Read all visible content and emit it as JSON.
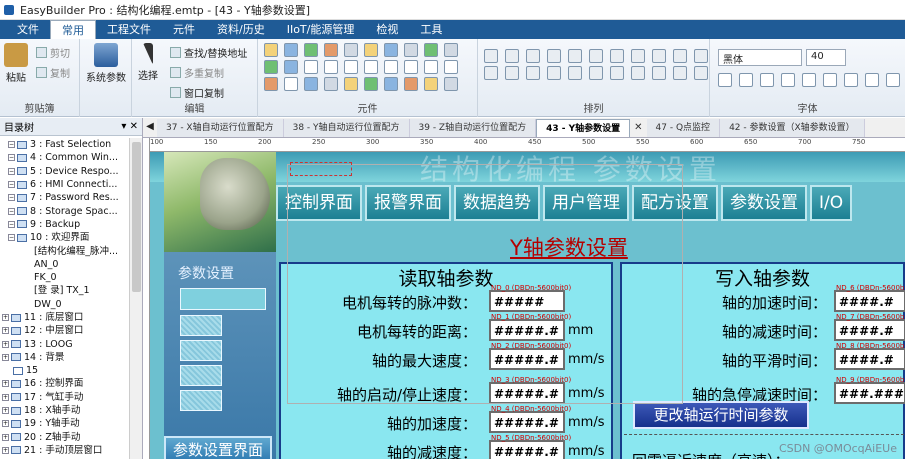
{
  "window": {
    "title": "EasyBuilder Pro : 结构化编程.emtp - [43 - Y轴参数设置]"
  },
  "menu": [
    "文件",
    "常用",
    "工程文件",
    "元件",
    "资料/历史",
    "IIoT/能源管理",
    "检视",
    "工具"
  ],
  "menu_active": "常用",
  "ribbon": {
    "clipboard": {
      "paste": "粘贴",
      "cut": "剪切",
      "copy": "复制",
      "group": "剪贴簿"
    },
    "system_params": "系统参数",
    "edit": {
      "select": "选择",
      "find": "查找/替换地址",
      "multi_copy": "多重复制",
      "window_copy": "窗口复制",
      "group": "编辑"
    },
    "elements_group": "元件",
    "arrange_group": "排列",
    "font": {
      "family": "黑体",
      "size": "40",
      "group": "字体"
    }
  },
  "tree": {
    "header": "目录树",
    "items": [
      "3 : Fast Selection",
      "4 : Common Win...",
      "5 : Device Respo...",
      "6 : HMI Connecti...",
      "7 : Password Res...",
      "8 : Storage Spac...",
      "9 : Backup",
      "10 : 欢迎界面",
      "[结构化编程_脉冲...",
      "AN_0",
      "FK_0",
      "[登 录] TX_1",
      "DW_0",
      "11 : 底层窗口",
      "12 : 中层窗口",
      "13 : LOOG",
      "14 : 背景",
      "15",
      "16 : 控制界面",
      "17 : 气缸手动",
      "18 : X轴手动",
      "19 : Y轴手动",
      "20 : Z轴手动",
      "21 : 手动顶层窗口"
    ]
  },
  "tabs": [
    "37 - X轴自动运行位置配方",
    "38 - Y轴自动运行位置配方",
    "39 - Z轴自动运行位置配方",
    "43 - Y轴参数设置",
    "47 - Q点监控",
    "42 - 参数设置（X轴参数设置）"
  ],
  "tab_active": "43 - Y轴参数设置",
  "ruler_ticks": [
    "100",
    "150",
    "200",
    "250",
    "300",
    "350",
    "400",
    "450",
    "500",
    "550",
    "600",
    "650",
    "700",
    "750"
  ],
  "screen": {
    "bg_title": "结构化编程 参数设置",
    "side_title": "参数设置",
    "side_bottom": "参数设置界面",
    "nav": [
      "控制界面",
      "报警界面",
      "数据趋势",
      "用户管理",
      "配方设置",
      "参数设置",
      "I/O"
    ],
    "title": "Y轴参数设置",
    "read": {
      "title": "读取轴参数",
      "fields": [
        {
          "label": "电机每转的脉冲数：",
          "value": "#####",
          "unit": "",
          "tag": "ND_0 (DBDn-5600bit0)"
        },
        {
          "label": "电机每转的距离：",
          "value": "#####.#",
          "unit": "mm",
          "tag": "ND_1 (DBDn-5600bit0)"
        },
        {
          "label": "轴的最大速度：",
          "value": "#####.#",
          "unit": "mm/s",
          "tag": "ND_2 (DBDn-5600bit0)"
        },
        {
          "label": "轴的启动/停止速度：",
          "value": "#####.#",
          "unit": "mm/s",
          "tag": "ND_3 (DBDn-5600bit0)"
        },
        {
          "label": "轴的加速度：",
          "value": "#####.#",
          "unit": "mm/s",
          "tag": "ND_4 (DBDn-5600bit0)"
        },
        {
          "label": "轴的减速度：",
          "value": "#####.#",
          "unit": "mm/s",
          "tag": "ND_5 (DBDn-5600bit0)"
        }
      ]
    },
    "write": {
      "title": "写入轴参数",
      "fields": [
        {
          "label": "轴的加速时间：",
          "value": "####.#",
          "tag": "ND_6 (DBDn-5600bit0)"
        },
        {
          "label": "轴的减速时间：",
          "value": "####.#",
          "tag": "ND_7 (DBDn-5600bit0)"
        },
        {
          "label": "轴的平滑时间：",
          "value": "####.#",
          "tag": "ND_8 (DBDn-5600bit0)"
        },
        {
          "label": "轴的急停减速时间：",
          "value": "###.###",
          "tag": "ND_9 (DBDn-5600bit0)"
        }
      ],
      "change_button": "更改轴运行时间参数",
      "bottom_label": "回零逼近速度（高速）："
    }
  },
  "watermark": "CSDN @OMOcqAiEUe"
}
